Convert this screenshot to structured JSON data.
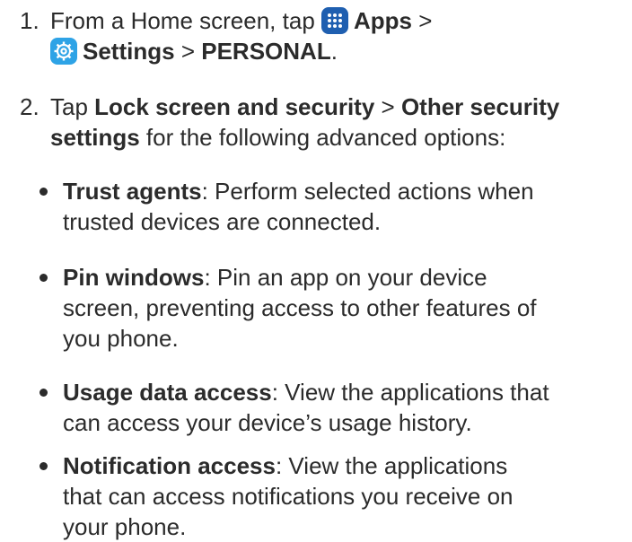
{
  "step1": {
    "number": "1.",
    "prefix": "From a Home screen, tap",
    "apps_label": "Apps",
    "sep1": ">",
    "settings_label": "Settings",
    "sep2": ">",
    "personal_label": "PERSONAL",
    "period": "."
  },
  "step2": {
    "number": "2.",
    "tap": "Tap",
    "lock_label": "Lock screen and security",
    "sep": ">",
    "other_label_line1": "Other security",
    "other_label_line2": "settings",
    "suffix": "for the following advanced options:"
  },
  "bullets": [
    {
      "term": "Trust agents",
      "line1": ": Perform selected actions when",
      "line2": "trusted devices are connected.",
      "line3": ""
    },
    {
      "term": "Pin windows",
      "line1": ": Pin an app on your device",
      "line2": "screen, preventing access to other features of",
      "line3": "you phone."
    },
    {
      "term": "Usage data access",
      "line1": ": View the applications that",
      "line2": "can access your device’s usage history.",
      "line3": ""
    },
    {
      "term": "Notification access",
      "line1": ": View the applications",
      "line2": "that can access notifications you receive on",
      "line3": "your phone."
    }
  ],
  "colors": {
    "text": "#2b2b2b",
    "apps_icon": "#1f5fb0",
    "settings_icon": "#2ea3e6"
  },
  "icons": {
    "apps": "apps-grid-icon",
    "settings": "settings-gear-icon"
  }
}
